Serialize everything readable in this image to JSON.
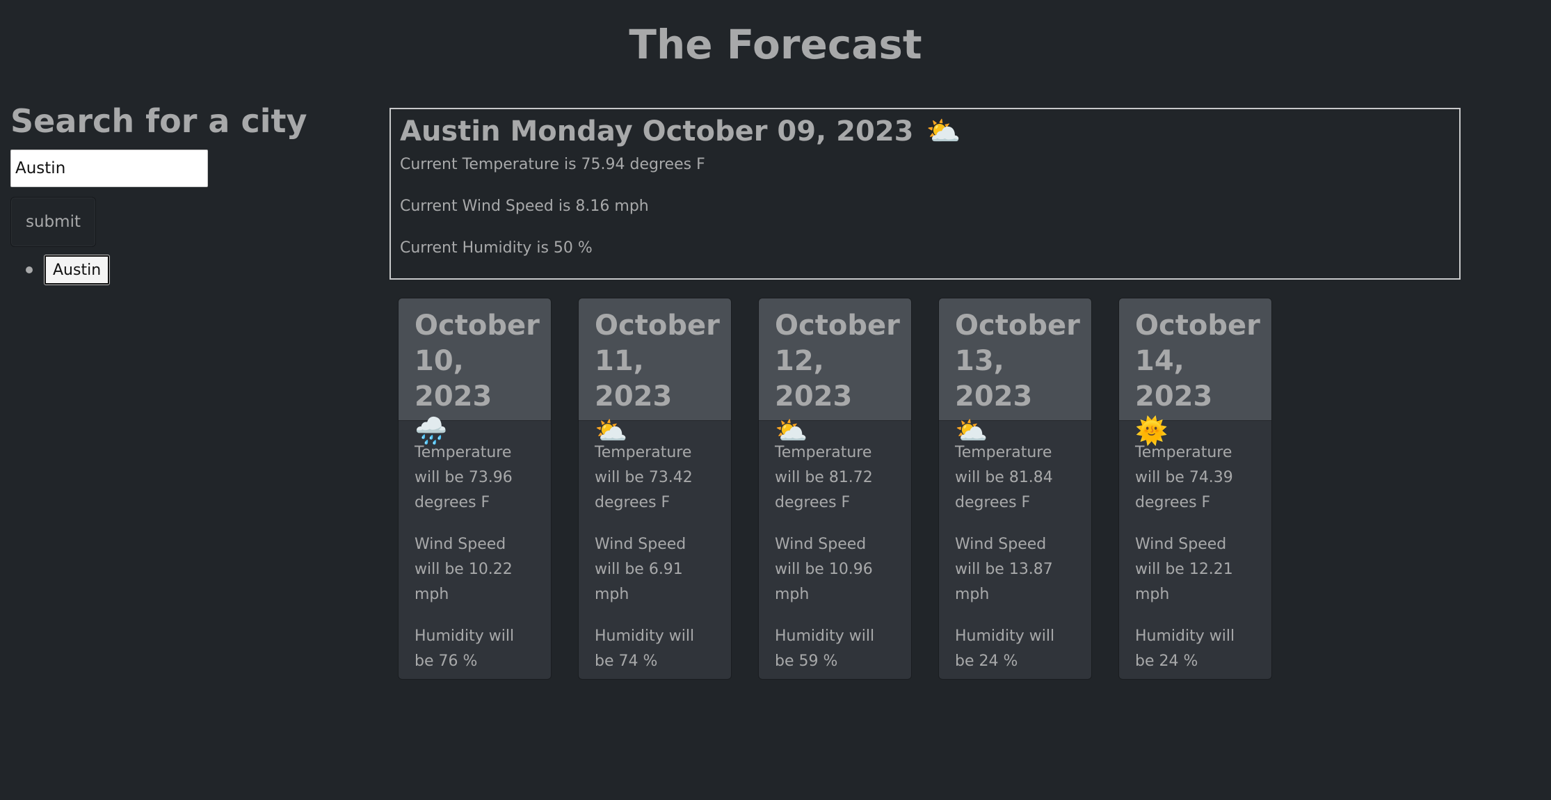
{
  "header": {
    "title": "The Forecast"
  },
  "search": {
    "heading": "Search for a city",
    "input_value": "Austin",
    "submit_label": "submit",
    "history": [
      "Austin"
    ]
  },
  "current": {
    "title": "Austin Monday October 09, 2023",
    "icon": "sun-behind-cloud",
    "icon_glyph": "⛅",
    "temperature": "Current Temperature is 75.94 degrees F",
    "wind": "Current Wind Speed is 8.16 mph",
    "humidity": "Current Humidity is 50 %"
  },
  "forecast": [
    {
      "date": "October 10, 2023",
      "icon": "rain-cloud",
      "icon_glyph": "🌧️",
      "temp": "Temperature will be 73.96 degrees F",
      "wind": "Wind Speed will be 10.22 mph",
      "humidity": "Humidity will be 76 %"
    },
    {
      "date": "October 11, 2023",
      "icon": "sun-behind-cloud",
      "icon_glyph": "⛅",
      "temp": "Temperature will be 73.42 degrees F",
      "wind": "Wind Speed will be 6.91 mph",
      "humidity": "Humidity will be 74 %"
    },
    {
      "date": "October 12, 2023",
      "icon": "sun-behind-cloud",
      "icon_glyph": "⛅",
      "temp": "Temperature will be 81.72 degrees F",
      "wind": "Wind Speed will be 10.96 mph",
      "humidity": "Humidity will be 59 %"
    },
    {
      "date": "October 13, 2023",
      "icon": "sun-behind-cloud",
      "icon_glyph": "⛅",
      "temp": "Temperature will be 81.84 degrees F",
      "wind": "Wind Speed will be 13.87 mph",
      "humidity": "Humidity will be 24 %"
    },
    {
      "date": "October 14, 2023",
      "icon": "sun-with-face",
      "icon_glyph": "🌞",
      "temp": "Temperature will be 74.39 degrees F",
      "wind": "Wind Speed will be 12.21 mph",
      "humidity": "Humidity will be 24 %"
    }
  ]
}
